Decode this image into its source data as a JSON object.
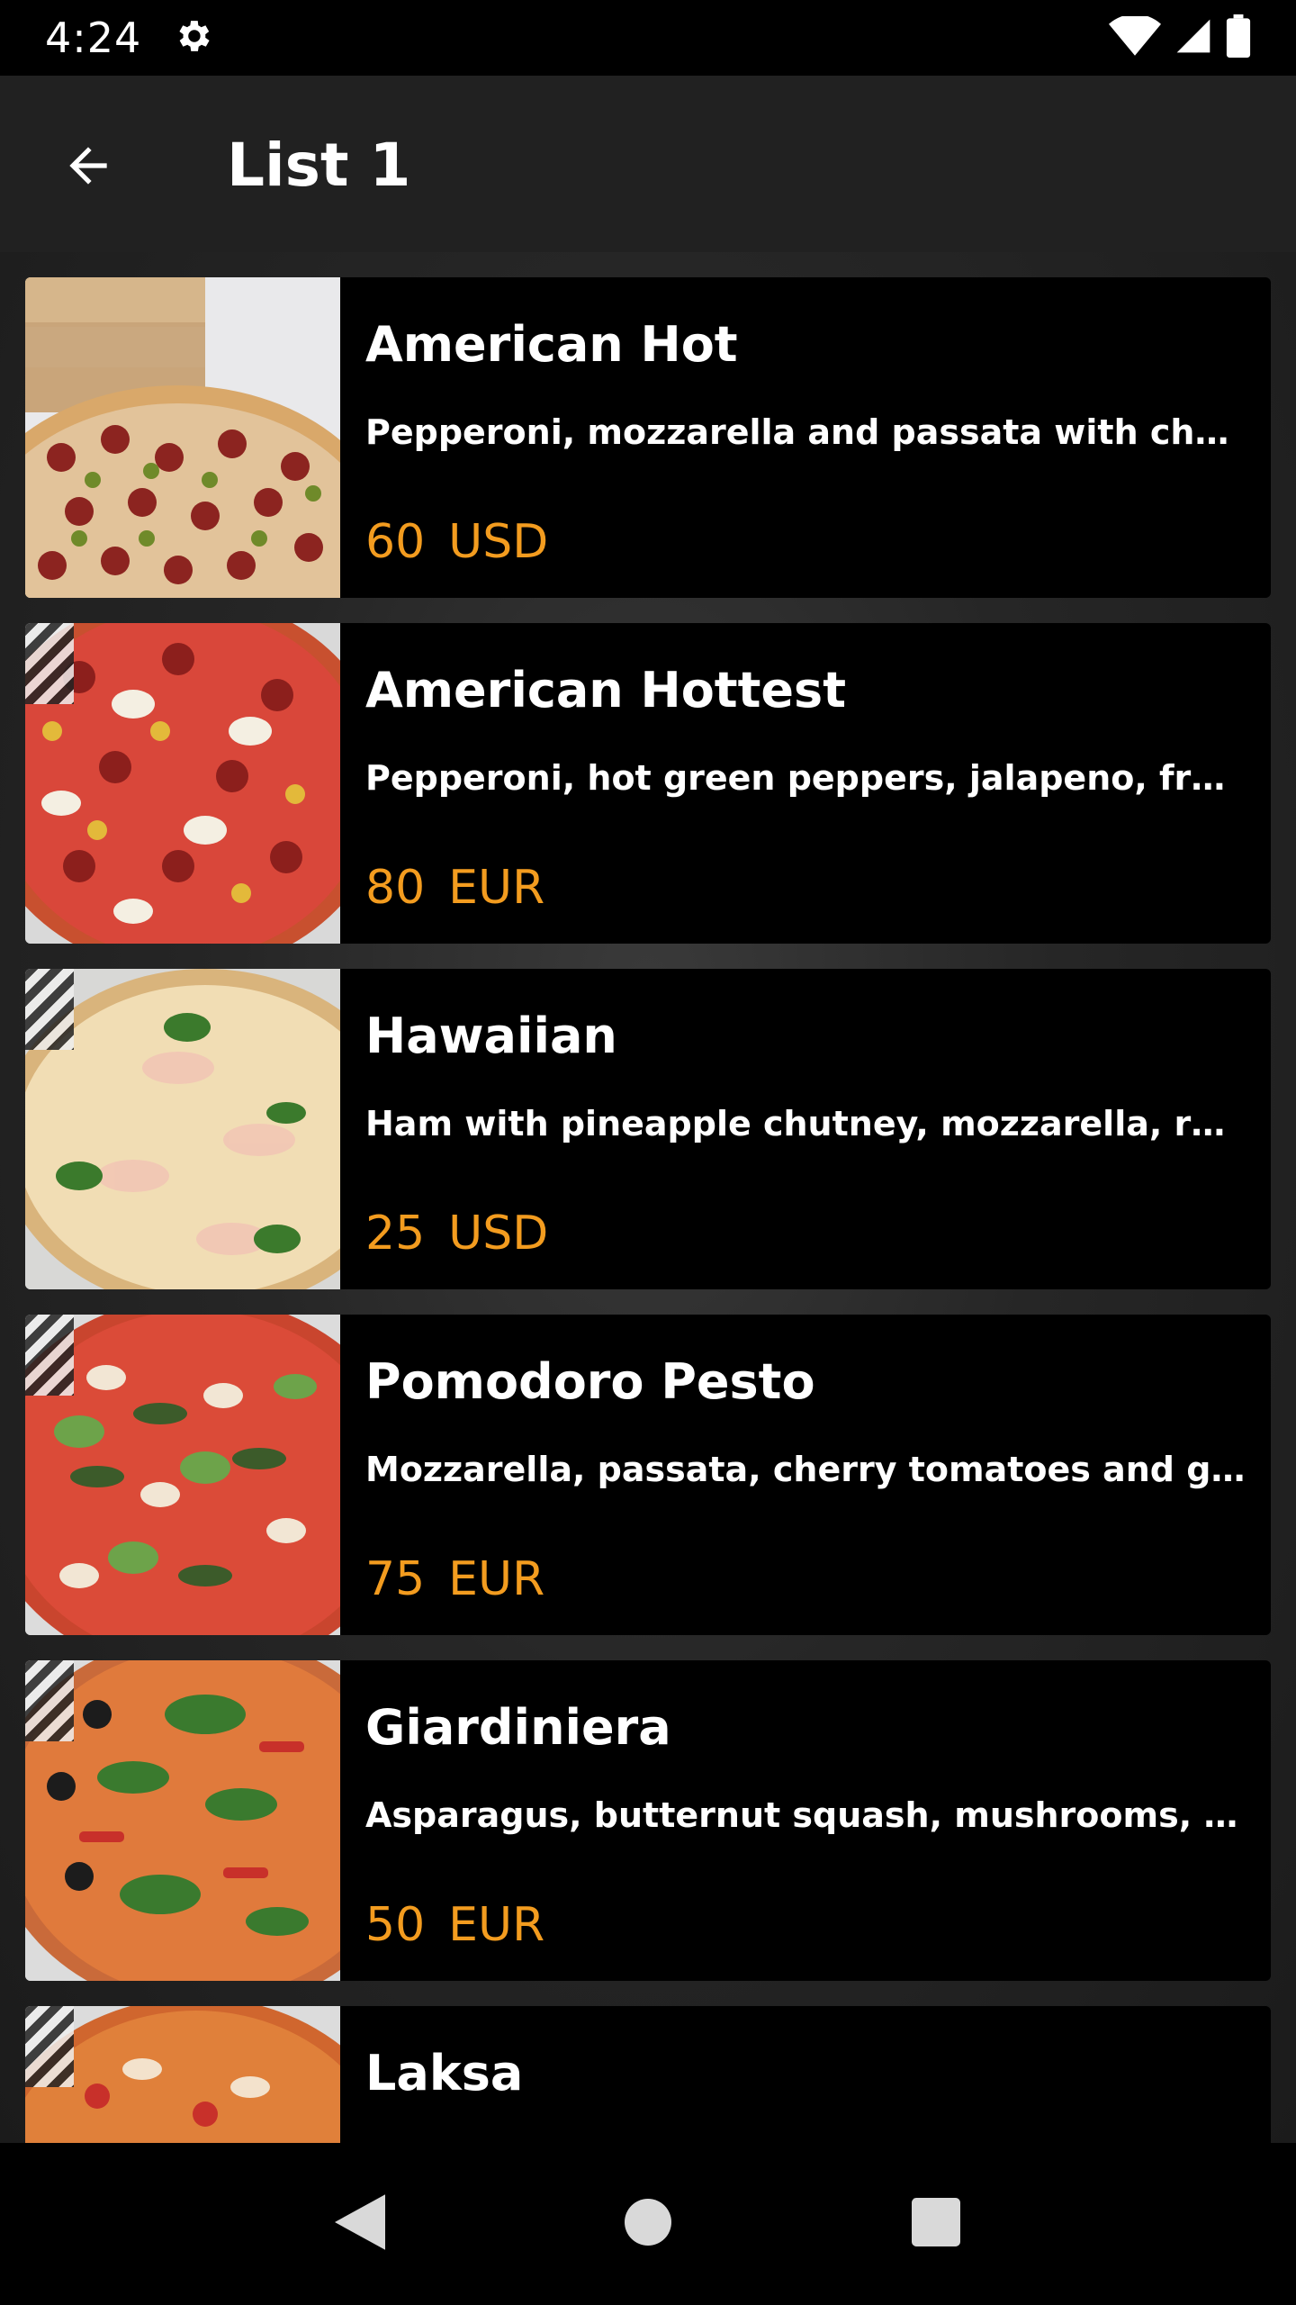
{
  "status_bar": {
    "time": "4:24",
    "icons": [
      "settings-icon",
      "wifi-icon",
      "signal-icon",
      "battery-icon"
    ]
  },
  "app_bar": {
    "title": "List 1",
    "back_icon": "arrow-back-icon"
  },
  "colors": {
    "price": "#f39c1f",
    "card_bg": "#000000",
    "app_bar_bg": "#212121"
  },
  "items": [
    {
      "title": "American Hot",
      "description": "Pepperoni, mozzarella and passata with choice of hot green peppers",
      "price": "60",
      "currency": "USD"
    },
    {
      "title": "American Hottest",
      "description": "Pepperoni, hot green peppers, jalapeno, fresh red chilli",
      "price": "80",
      "currency": "EUR"
    },
    {
      "title": "Hawaiian",
      "description": "Ham with pineapple chutney, mozzarella, red onion and basil",
      "price": "25",
      "currency": "USD"
    },
    {
      "title": "Pomodoro Pesto",
      "description": "Mozzarella, passata, cherry tomatoes and garlic oil with pesto",
      "price": "75",
      "currency": "EUR"
    },
    {
      "title": "Giardiniera",
      "description": "Asparagus, butternut squash, mushrooms, roasted peppers and olives",
      "price": "50",
      "currency": "EUR"
    },
    {
      "title": "Laksa",
      "description": "",
      "price": "",
      "currency": ""
    }
  ],
  "nav_bar": {
    "icons": [
      "back-triangle-icon",
      "home-circle-icon",
      "recents-square-icon"
    ]
  }
}
